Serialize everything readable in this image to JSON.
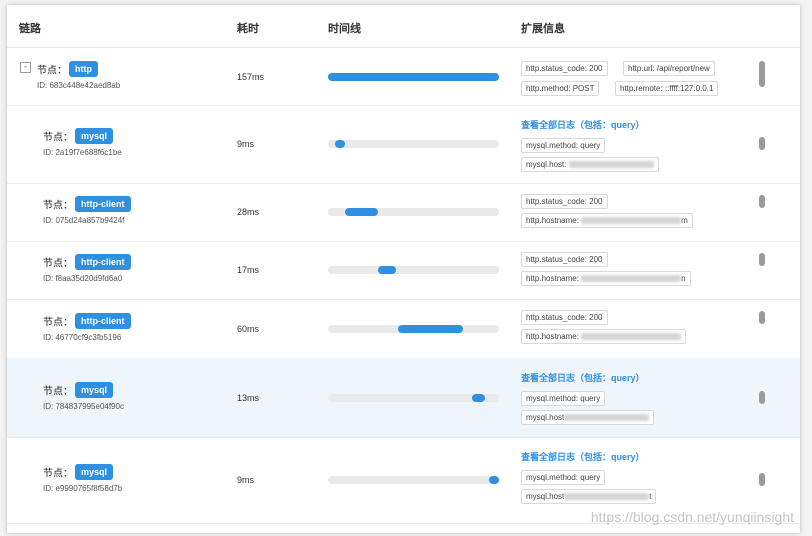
{
  "header": {
    "col_chain": "链路",
    "col_duration": "耗时",
    "col_timeline": "时间线",
    "col_ext": "扩展信息"
  },
  "node_prefix": "节点：",
  "rows": [
    {
      "tag": "http",
      "id": "ID: 683c448e42aed8ab",
      "duration": "157ms",
      "bar_start": 0.0,
      "bar_end": 1.0,
      "kv": [
        "http.status_code: 200",
        "http.url: /api/report/new",
        "http.method: POST",
        "http.remote: ::ffff:127.0.0.1"
      ]
    },
    {
      "tag": "mysql",
      "id": "ID: 2a19f7e688f6c1be",
      "duration": "9ms",
      "bar_start": 0.04,
      "bar_end": 0.1,
      "link": "查看全部日志（包括：query）",
      "kv": [
        "mysql.method: query",
        "mysql.host: "
      ]
    },
    {
      "tag": "http-client",
      "id": "ID: 075d24a857b9424f",
      "duration": "28ms",
      "bar_start": 0.1,
      "bar_end": 0.29,
      "kv": [
        "http.status_code: 200",
        "http.hostname: ",
        "m"
      ]
    },
    {
      "tag": "http-client",
      "id": "ID: f8aa35d20d9fd6a0",
      "duration": "17ms",
      "bar_start": 0.29,
      "bar_end": 0.4,
      "kv": [
        "http.status_code: 200",
        "http.hostname: ",
        "n"
      ]
    },
    {
      "tag": "http-client",
      "id": "ID: 46770cf9c3fb5196",
      "duration": "60ms",
      "bar_start": 0.41,
      "bar_end": 0.79,
      "kv": [
        "http.status_code: 200",
        "http.hostname: "
      ]
    },
    {
      "tag": "mysql",
      "id": "ID: 784837995e04f90c",
      "duration": "13ms",
      "bar_start": 0.84,
      "bar_end": 0.92,
      "link": "查看全部日志（包括：query）",
      "kv": [
        "mysql.method: query",
        "mysql.host"
      ]
    },
    {
      "tag": "mysql",
      "id": "ID: e9990765f8f58d7b",
      "duration": "9ms",
      "bar_start": 0.94,
      "bar_end": 1.0,
      "link": "查看全部日志（包括：query）",
      "kv": [
        "mysql.method: query",
        "mysql.host",
        "t"
      ]
    }
  ],
  "watermark": "https://blog.csdn.net/yunqiinsight",
  "colors": {
    "accent": "#2f8fe0",
    "track": "#e9e9e9",
    "highlight_row": "#eef6fc"
  }
}
